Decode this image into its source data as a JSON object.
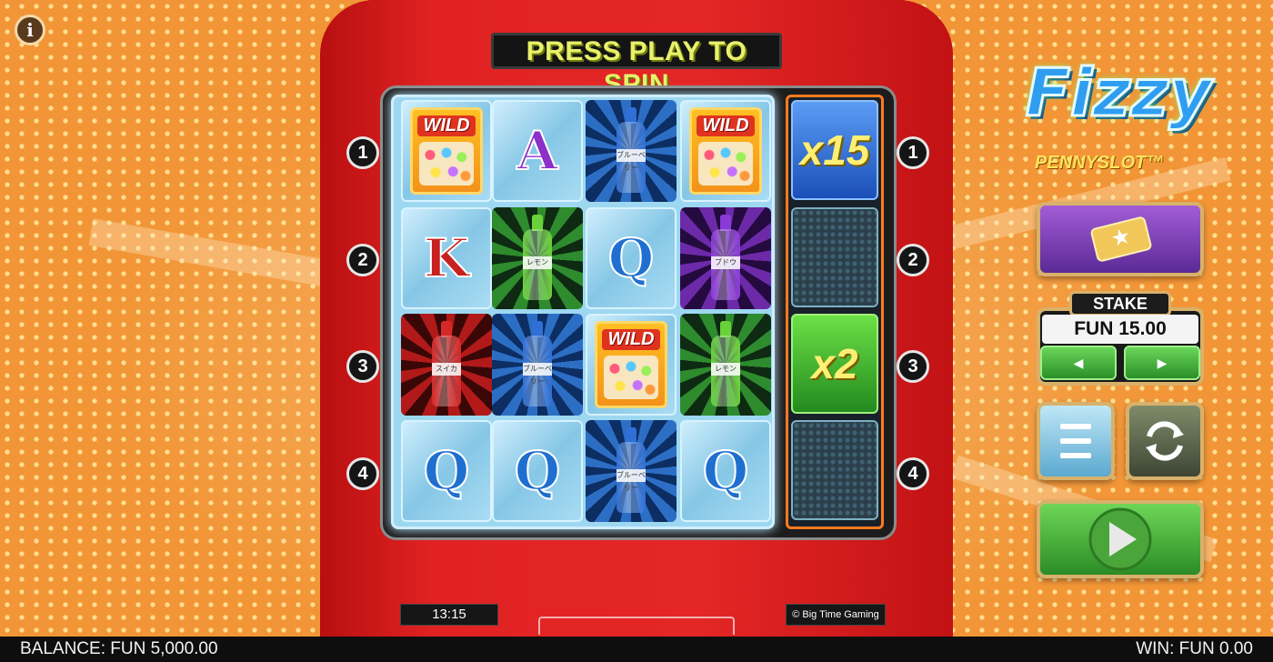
{
  "header": {
    "banner": "PRESS PLAY TO SPIN"
  },
  "logo": {
    "title": "Fizzy",
    "subtitle": "PENNYSLOT™"
  },
  "rows": [
    "1",
    "2",
    "3",
    "4"
  ],
  "grid": [
    [
      {
        "kind": "wild",
        "text": "WILD"
      },
      {
        "kind": "letter",
        "text": "A",
        "color": "#8d2fc9"
      },
      {
        "kind": "bottle",
        "text": "ブルーベリー",
        "color": "#2f6fd6",
        "bg": "swirl-blue"
      },
      {
        "kind": "wild",
        "text": "WILD"
      }
    ],
    [
      {
        "kind": "letter",
        "text": "K",
        "color": "#c92020"
      },
      {
        "kind": "bottle",
        "text": "レモン",
        "color": "#6ad13a",
        "bg": "swirl-green"
      },
      {
        "kind": "letter",
        "text": "Q",
        "color": "#1f6fd0"
      },
      {
        "kind": "bottle",
        "text": "ブドウ",
        "color": "#8a3ad8",
        "bg": "swirl-purple"
      }
    ],
    [
      {
        "kind": "bottle",
        "text": "スイカ",
        "color": "#d62828",
        "bg": "swirl-red"
      },
      {
        "kind": "bottle",
        "text": "ブルーベリー",
        "color": "#2f6fd6",
        "bg": "swirl-blue"
      },
      {
        "kind": "wild",
        "text": "WILD"
      },
      {
        "kind": "bottle",
        "text": "レモン",
        "color": "#6ad13a",
        "bg": "swirl-green"
      }
    ],
    [
      {
        "kind": "letter",
        "text": "Q",
        "color": "#1f6fd0"
      },
      {
        "kind": "letter",
        "text": "Q",
        "color": "#1f6fd0"
      },
      {
        "kind": "bottle",
        "text": "ブルーベリー",
        "color": "#2f6fd6",
        "bg": "swirl-blue"
      },
      {
        "kind": "letter",
        "text": "Q",
        "color": "#1f6fd0"
      }
    ]
  ],
  "multipliers": [
    {
      "label": "x15",
      "style": "blue"
    },
    {
      "label": "",
      "style": "empty"
    },
    {
      "label": "x2",
      "style": "green"
    },
    {
      "label": "",
      "style": "empty"
    }
  ],
  "controls": {
    "stake_label": "STAKE",
    "stake_value": "FUN 15.00",
    "stake_down": "◀",
    "stake_up": "▶"
  },
  "footer": {
    "time": "13:15",
    "copyright": "© Big Time Gaming",
    "balance": "BALANCE: FUN 5,000.00",
    "win": "WIN: FUN 0.00"
  },
  "info_icon": "i",
  "colors": {
    "accent": "#ff7a1e",
    "gold": "#d8b16a",
    "banner_text": "#e9f06a"
  }
}
